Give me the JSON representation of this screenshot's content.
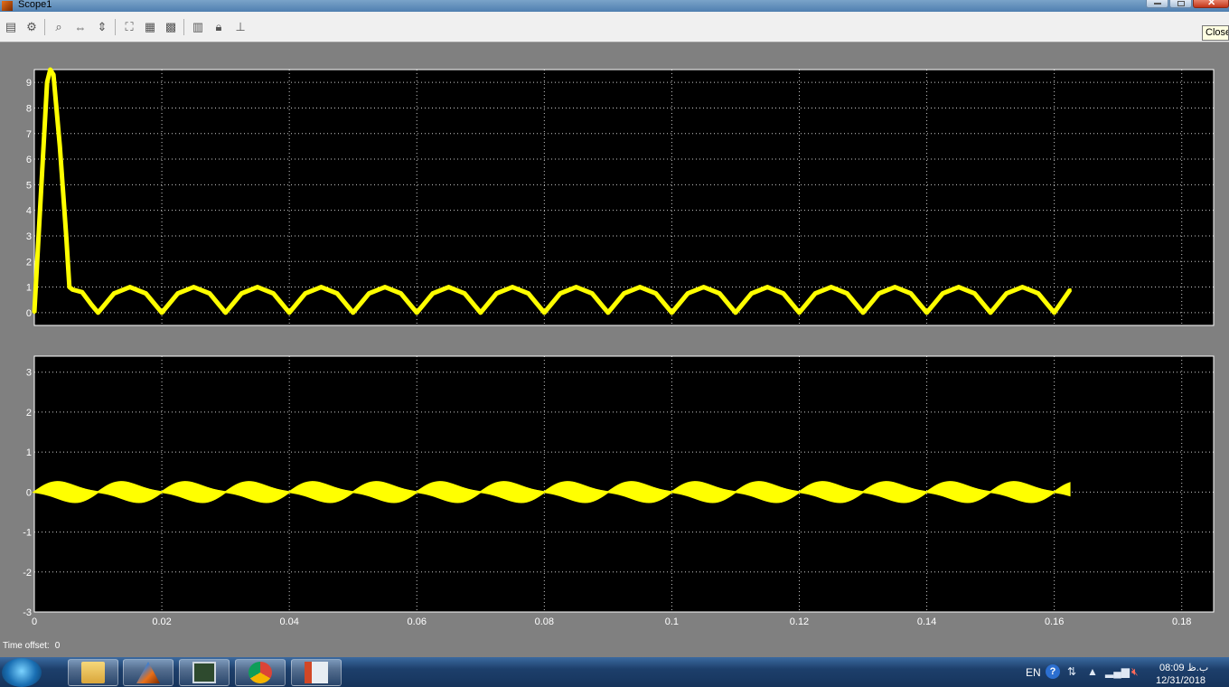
{
  "window": {
    "title": "Scope1",
    "tooltip": "Close"
  },
  "toolbar": {
    "buttons": [
      "print-icon",
      "parameters-icon",
      "zoom-icon",
      "zoom-x-icon",
      "zoom-y-icon",
      "autoscale-icon",
      "save-axes-icon",
      "restore-axes-icon",
      "floating-scope-icon",
      "lock-axes-icon",
      "signal-selector-icon"
    ]
  },
  "status": {
    "time_offset_label": "Time offset:",
    "time_offset_value": "0"
  },
  "taskbar": {
    "apps": [
      "file-explorer-icon",
      "matlab-icon",
      "simulink-icon",
      "chrome-icon",
      "office-icon"
    ],
    "language": "EN",
    "help_label": "?",
    "time": "08:09 ب.ظ",
    "date": "12/31/2018"
  },
  "colors": {
    "plot_background": "#000000",
    "signal": "#ffff00",
    "grid": "#ffffff",
    "figure_background": "#808080"
  },
  "chart_data": [
    {
      "type": "line",
      "title": "",
      "xlabel": "",
      "ylabel": "",
      "xlim": [
        0,
        0.185
      ],
      "ylim": [
        -0.5,
        9.5
      ],
      "yticks": [
        0,
        1,
        2,
        3,
        4,
        5,
        6,
        7,
        8,
        9
      ],
      "xticks": [
        0,
        0.02,
        0.04,
        0.06,
        0.08,
        0.1,
        0.12,
        0.14,
        0.16,
        0.18
      ],
      "grid": true,
      "series": [
        {
          "values_description_free": true,
          "x": [
            0,
            0.001,
            0.002,
            0.0025,
            0.003,
            0.004,
            0.005,
            0.0055,
            0.006,
            0.0075,
            0.009,
            0.01,
            0.0125,
            0.015,
            0.0175,
            0.02,
            0.0225,
            0.025,
            0.0275,
            0.03,
            0.0325,
            0.035,
            0.0375,
            0.04,
            0.0425,
            0.045,
            0.0475,
            0.05,
            0.0525,
            0.055,
            0.0575,
            0.06,
            0.0625,
            0.065,
            0.0675,
            0.07,
            0.0725,
            0.075,
            0.0775,
            0.08,
            0.0825,
            0.085,
            0.0875,
            0.09,
            0.0925,
            0.095,
            0.0975,
            0.1,
            0.1025,
            0.105,
            0.1075,
            0.11,
            0.1125,
            0.115,
            0.1175,
            0.12,
            0.1225,
            0.125,
            0.1275,
            0.13,
            0.1325,
            0.135,
            0.1375,
            0.14,
            0.1425,
            0.145,
            0.1475,
            0.15,
            0.1525,
            0.155,
            0.1575,
            0.16,
            0.1625
          ],
          "y": [
            0,
            4.5,
            9.0,
            9.5,
            9.3,
            6.5,
            3.0,
            1.0,
            0.9,
            0.8,
            0.3,
            0,
            0.75,
            1.0,
            0.75,
            0,
            0.75,
            1.0,
            0.75,
            0,
            0.75,
            1.0,
            0.75,
            0,
            0.75,
            1.0,
            0.75,
            0,
            0.75,
            1.0,
            0.75,
            0,
            0.75,
            1.0,
            0.75,
            0,
            0.75,
            1.0,
            0.75,
            0,
            0.75,
            1.0,
            0.75,
            0,
            0.75,
            1.0,
            0.75,
            0,
            0.75,
            1.0,
            0.75,
            0,
            0.75,
            1.0,
            0.75,
            0,
            0.75,
            1.0,
            0.75,
            0,
            0.75,
            1.0,
            0.75,
            0,
            0.75,
            1.0,
            0.75,
            0,
            0.75,
            1.0,
            0.75,
            0,
            0.9
          ]
        }
      ]
    },
    {
      "type": "line",
      "title": "",
      "xlabel": "",
      "ylabel": "",
      "xlim": [
        0,
        0.185
      ],
      "ylim": [
        -3,
        3.4
      ],
      "yticks": [
        -3,
        -2,
        -1,
        0,
        1,
        2,
        3
      ],
      "xticks": [
        0,
        0.02,
        0.04,
        0.06,
        0.08,
        0.1,
        0.12,
        0.14,
        0.16,
        0.18
      ],
      "xticklabels": [
        "0",
        "0.02",
        "0.04",
        "0.06",
        "0.08",
        "0.1",
        "0.12",
        "0.14",
        "0.16",
        "0.18"
      ],
      "grid": true,
      "series": [
        {
          "band_amplitude": 0.22,
          "period": 0.01,
          "x_end": 0.1625
        }
      ]
    }
  ]
}
